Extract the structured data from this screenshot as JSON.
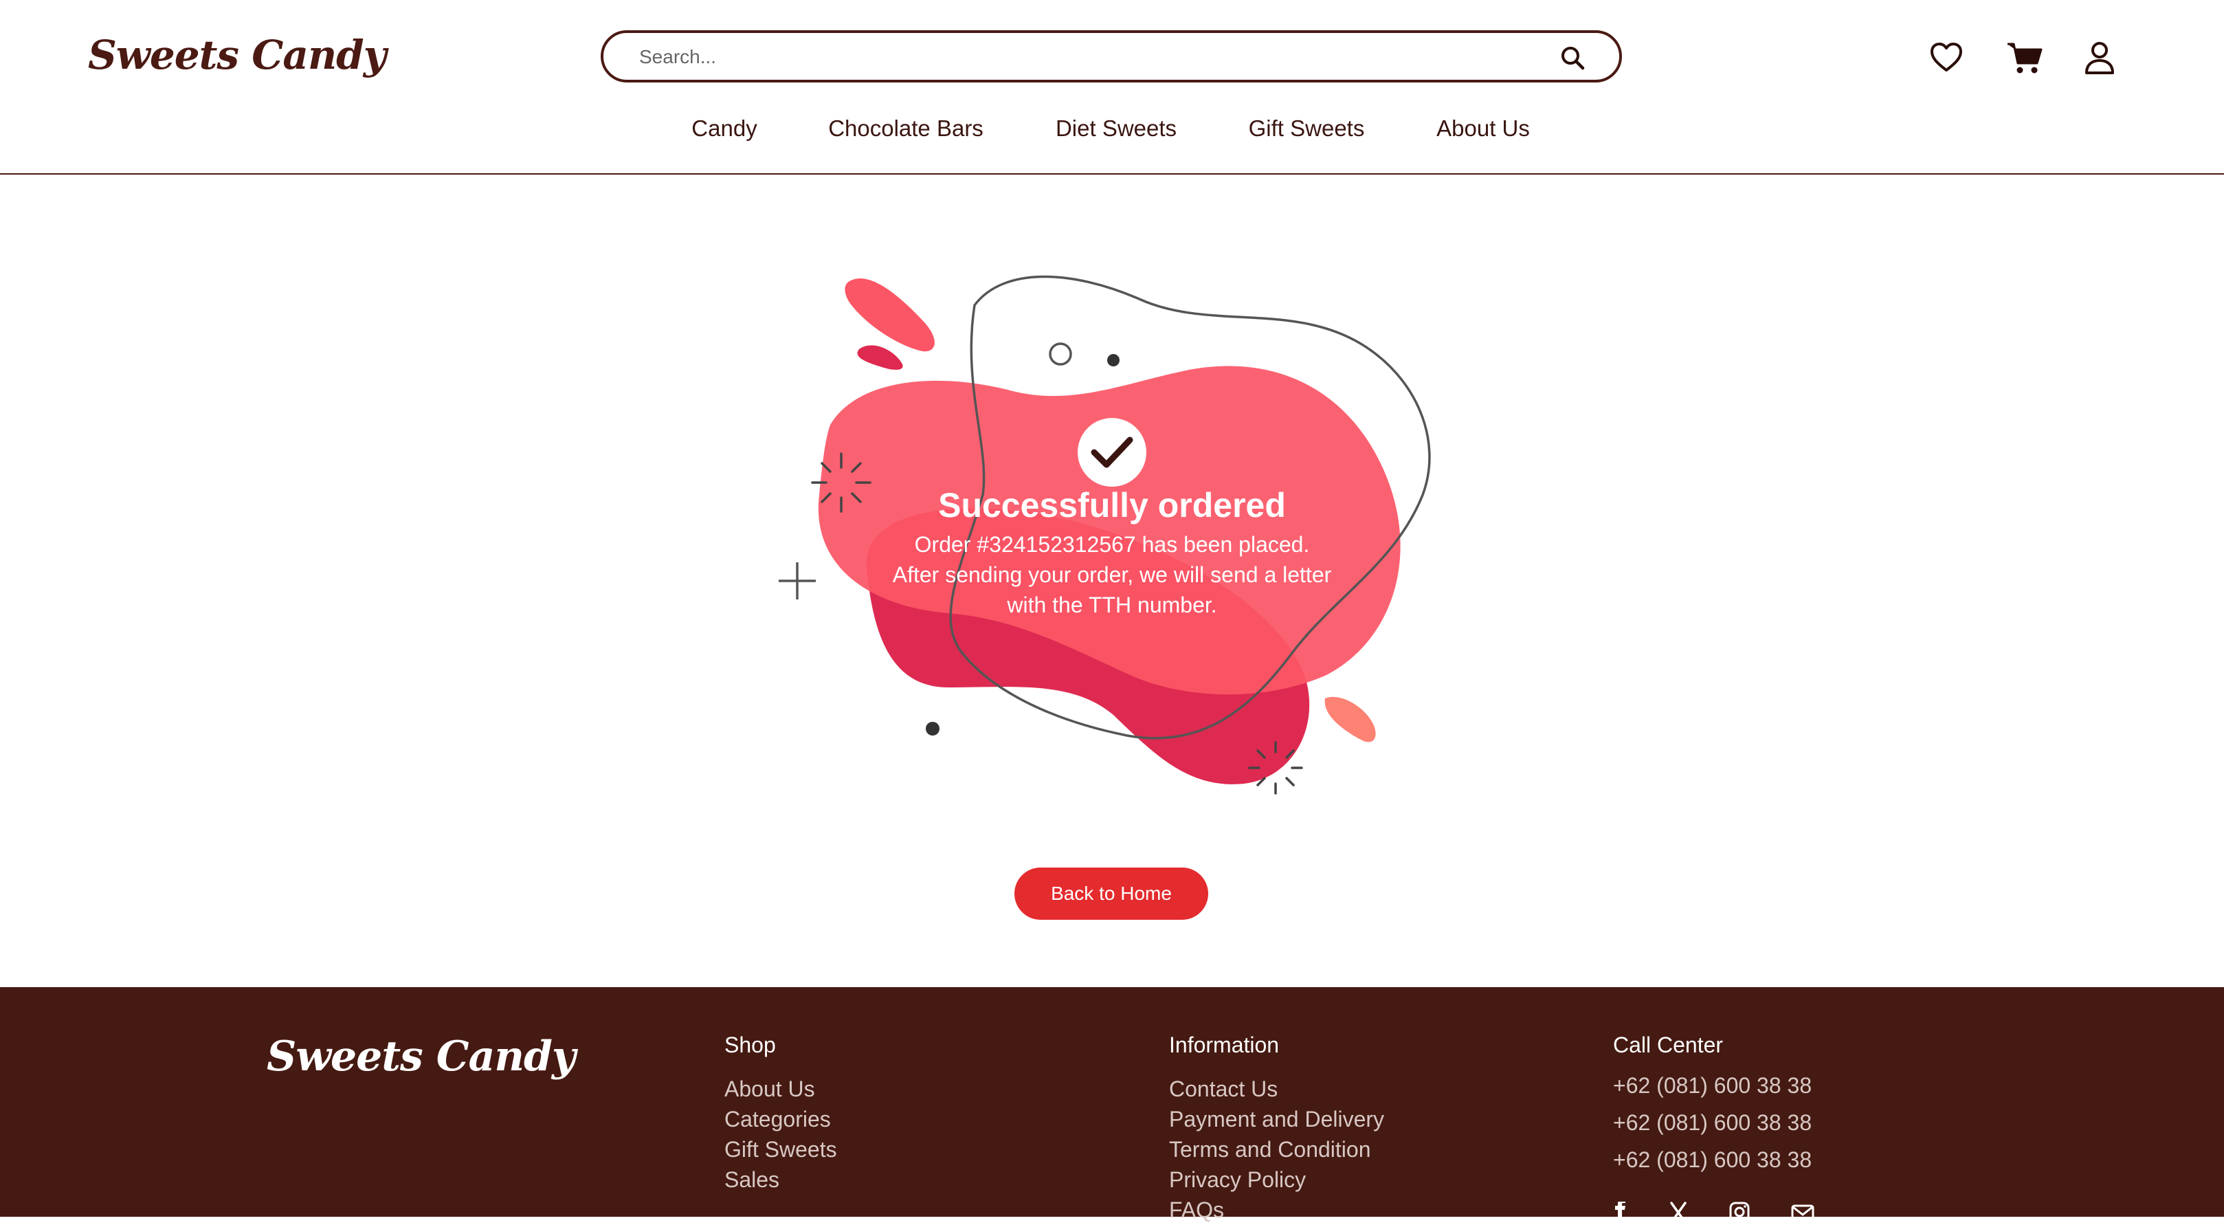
{
  "brand": {
    "name": "Sweets Candy"
  },
  "header": {
    "search": {
      "placeholder": "Search...",
      "icon": "search-icon"
    },
    "icons": [
      "heart-icon",
      "cart-icon",
      "user-icon"
    ],
    "nav": [
      {
        "label": "Candy"
      },
      {
        "label": "Chocolate Bars"
      },
      {
        "label": "Diet Sweets"
      },
      {
        "label": "Gift Sweets"
      },
      {
        "label": "About Us"
      }
    ]
  },
  "main": {
    "title": "Successfully ordered",
    "line1": "Order #324152312567 has been placed.",
    "line2": "After sending your order, we will send a letter",
    "line3": "with the TTH number.",
    "icon": "check-icon",
    "button_label": "Back to Home"
  },
  "footer": {
    "shop": {
      "heading": "Shop",
      "items": [
        "About Us",
        "Categories",
        "Gift Sweets",
        "Sales"
      ]
    },
    "information": {
      "heading": "Information",
      "items": [
        "Contact Us",
        "Payment and Delivery",
        "Terms and Condition",
        "Privacy Policy",
        "FAQs"
      ]
    },
    "call_center": {
      "heading": "Call Center",
      "phones": [
        "+62 (081) 600 38 38",
        "+62 (081) 600 38 38",
        "+62 (081) 600 38 38"
      ]
    },
    "socials": [
      "facebook-icon",
      "x-icon",
      "instagram-icon",
      "mail-icon"
    ]
  },
  "colors": {
    "brand_brown": "#4a1a13",
    "footer_bg": "#451a12",
    "accent_red": "#e42b2e",
    "blob_coral": "#fb5666",
    "blob_crimson": "#de2a50"
  }
}
